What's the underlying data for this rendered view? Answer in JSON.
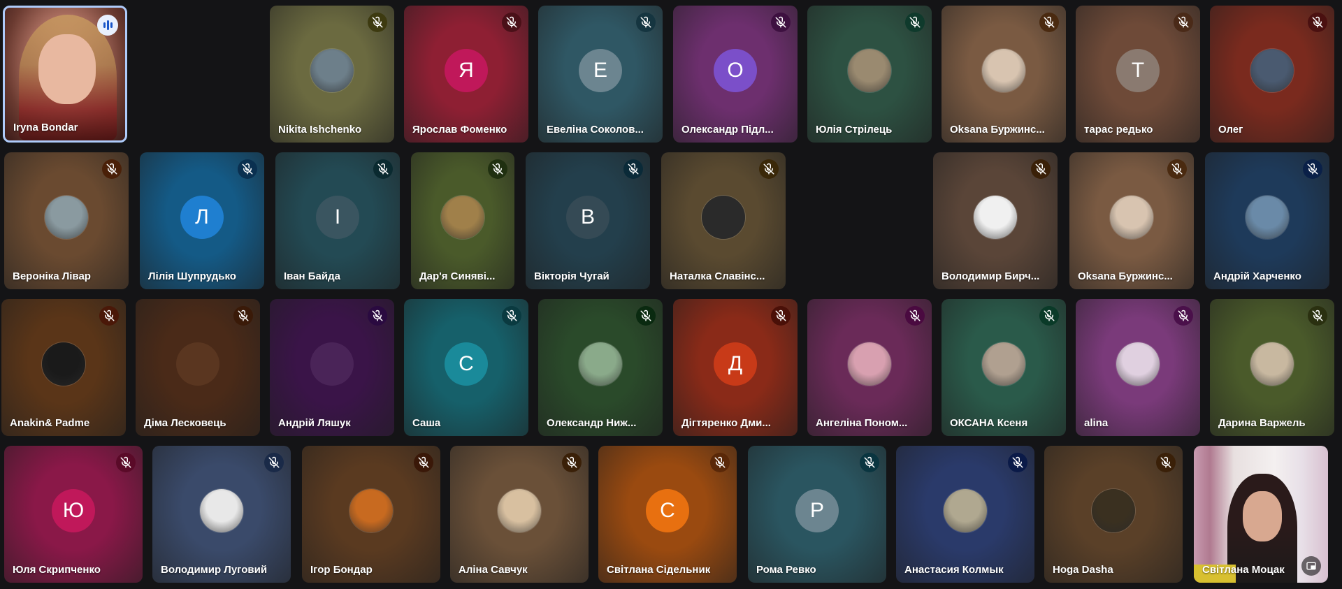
{
  "participants": [
    {
      "name": "Iryna Bondar",
      "type": "video",
      "speaking": true
    },
    {
      "name": "Nikita Ishchenko",
      "type": "photo",
      "bg": "#6b6a40",
      "photo": "#6d7f8a",
      "mic": "#3d3a10"
    },
    {
      "name": "Ярослав Фоменко",
      "type": "initial",
      "initial": "Я",
      "bg": "#8e1f33",
      "avatar_color": "#c0185a",
      "mic": "#4a1018"
    },
    {
      "name": "Евеліна Соколов...",
      "type": "initial",
      "initial": "Е",
      "bg": "#2f5764",
      "avatar_color": "#6c8590",
      "mic": "#153540"
    },
    {
      "name": "Олександр Підл...",
      "type": "initial",
      "initial": "О",
      "bg": "#6d2f6e",
      "avatar_color": "#7b4fc9",
      "mic": "#3d1040"
    },
    {
      "name": "Юлія Стрілець",
      "type": "photo",
      "bg": "#2d5142",
      "photo": "#9a8a70",
      "mic": "#0f3a2c"
    },
    {
      "name": "Oksana Буржинс...",
      "type": "photo",
      "bg": "#7a5a42",
      "photo": "#d8c4b0",
      "mic": "#4a2a10"
    },
    {
      "name": "тарас редько",
      "type": "initial",
      "initial": "Т",
      "bg": "#6e4a38",
      "avatar_color": "#8a7a70",
      "mic": "#4a2a18"
    },
    {
      "name": "Олег",
      "type": "photo",
      "bg": "#7a2a1e",
      "photo": "#4a5a70",
      "mic": "#4a1010"
    },
    {
      "name": "Вероніка Лівар",
      "type": "photo",
      "bg": "#6a4a30",
      "photo": "#8a9aa0",
      "mic": "#4a2008"
    },
    {
      "name": "Лілія Шупрудько",
      "type": "initial",
      "initial": "Л",
      "bg": "#145a86",
      "avatar_color": "#1f7fd0",
      "mic": "#0a3050"
    },
    {
      "name": "Іван Байда",
      "type": "initial",
      "initial": "І",
      "bg": "#234a54",
      "avatar_color": "#3a5560",
      "mic": "#0a2a30"
    },
    {
      "name": "Дар'я Синяві...",
      "type": "photo",
      "bg": "#4a5a2a",
      "photo": "#a0804a",
      "mic": "#203010"
    },
    {
      "name": "Вікторія Чугай",
      "type": "initial",
      "initial": "В",
      "bg": "#233f4c",
      "avatar_color": "#354a55",
      "mic": "#0a2a38"
    },
    {
      "name": "Наталка Славінс...",
      "type": "photo",
      "bg": "#5a4a30",
      "photo": "#2a2a2a",
      "mic": "#3a2808"
    },
    {
      "name": "Володимир Бирч...",
      "type": "photo",
      "bg": "#5a4538",
      "photo": "#f0f0f0",
      "mic": "#3a2008"
    },
    {
      "name": "Oksana Буржинс...",
      "type": "photo",
      "bg": "#7a5a42",
      "photo": "#d8c4b0",
      "mic": "#4a2a10"
    },
    {
      "name": "Андрій Харченко",
      "type": "photo",
      "bg": "#1e3a5a",
      "photo": "#6a8aa8",
      "mic": "#0a2048"
    },
    {
      "name": "Anakin& Padme",
      "type": "photo",
      "bg": "#5a3518",
      "photo": "#1a1a1a",
      "mic": "#4a1808"
    },
    {
      "name": "Діма Лесковець",
      "type": "blank",
      "bg": "#4a2a18",
      "avatar_color": "#5a3620",
      "mic": "#3a1a08"
    },
    {
      "name": "Андрій Ляшук",
      "type": "blank",
      "bg": "#3a1448",
      "avatar_color": "#4a2458",
      "mic": "#2a0a40"
    },
    {
      "name": "Саша",
      "type": "initial",
      "initial": "С",
      "bg": "#16606a",
      "avatar_color": "#1a8a9a",
      "mic": "#0a3a40"
    },
    {
      "name": "Олександр Ниж...",
      "type": "photo",
      "bg": "#2a4a2a",
      "photo": "#8aaa8a",
      "mic": "#0a2a10"
    },
    {
      "name": "Дігтяренко Дми...",
      "type": "initial",
      "initial": "Д",
      "bg": "#8a2a18",
      "avatar_color": "#c83a18",
      "mic": "#4a1008"
    },
    {
      "name": "Ангеліна Поном...",
      "type": "photo",
      "bg": "#6a2a58",
      "photo": "#d8a0b0",
      "mic": "#4a0a40"
    },
    {
      "name": "ОКСАНА Ксеня",
      "type": "photo",
      "bg": "#2a5a4a",
      "photo": "#b0a090",
      "mic": "#0a3a28"
    },
    {
      "name": "alina",
      "type": "photo",
      "bg": "#7a3a7a",
      "photo": "#e0d0e0",
      "mic": "#4a104a"
    },
    {
      "name": "Дарина Варжель",
      "type": "photo",
      "bg": "#4a5a2a",
      "photo": "#c8b8a0",
      "mic": "#2a3010"
    },
    {
      "name": "Юля Скрипченко",
      "type": "initial",
      "initial": "Ю",
      "bg": "#8a1848",
      "avatar_color": "#c0185a",
      "mic": "#5a0a28"
    },
    {
      "name": "Володимир Луговий",
      "type": "photo",
      "bg": "#3a4a6a",
      "photo": "#e8e8e8",
      "mic": "#1a2a48"
    },
    {
      "name": "Ігор Бондар",
      "type": "photo",
      "bg": "#5a3a20",
      "photo": "#c86a20",
      "mic": "#3a1808"
    },
    {
      "name": "Аліна Савчук",
      "type": "photo",
      "bg": "#6a5038",
      "photo": "#d8c0a0",
      "mic": "#3a2008"
    },
    {
      "name": "Світлана Сідельник",
      "type": "initial",
      "initial": "С",
      "bg": "#9a4a10",
      "avatar_color": "#e87010",
      "mic": "#5a2808"
    },
    {
      "name": "Рома Ревко",
      "type": "initial",
      "initial": "Р",
      "bg": "#2a5560",
      "avatar_color": "#6c8590",
      "mic": "#0a3540"
    },
    {
      "name": "Анастасия Колмык",
      "type": "photo",
      "bg": "#2a3a6a",
      "photo": "#b0a890",
      "mic": "#0a1a48"
    },
    {
      "name": "Hoga Dasha",
      "type": "photo",
      "bg": "#5a4028",
      "photo": "#3a3020",
      "mic": "#3a2008"
    },
    {
      "name": "Світлана Моцак",
      "type": "video2",
      "mic": "#3a3a3a"
    }
  ]
}
